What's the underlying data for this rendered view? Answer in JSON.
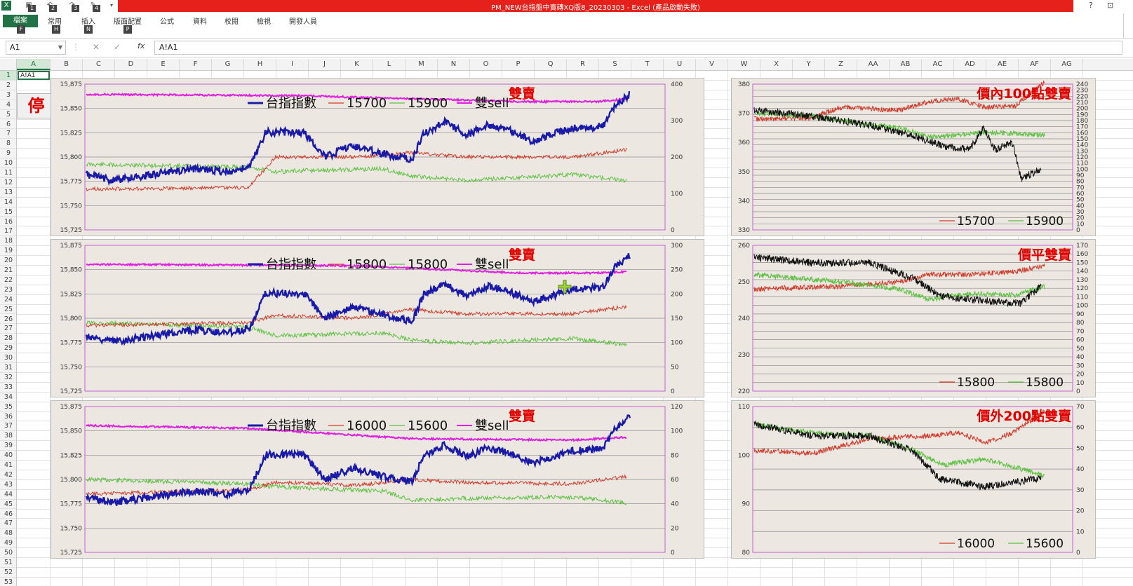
{
  "window": {
    "title": "PM_NEW台指盤中賣磚XQ版8_20230303 - Excel (產品啟動失敗)",
    "help": "?",
    "restore": "⊡"
  },
  "qat": {
    "keys": [
      "1",
      "2",
      "3",
      "4"
    ]
  },
  "ribbon": {
    "file": {
      "label": "檔案",
      "key": "F"
    },
    "tabs": [
      {
        "label": "常用",
        "key": "H"
      },
      {
        "label": "插入",
        "key": "N"
      },
      {
        "label": "版面配置",
        "key": "P"
      },
      {
        "label": "公式"
      },
      {
        "label": "資料"
      },
      {
        "label": "校閱"
      },
      {
        "label": "檢視"
      },
      {
        "label": "開發人員"
      }
    ]
  },
  "formula_bar": {
    "name_box": "A1",
    "formula": "A!A1"
  },
  "sheet": {
    "columns": [
      "A",
      "B",
      "C",
      "D",
      "E",
      "F",
      "G",
      "H",
      "I",
      "J",
      "K",
      "L",
      "M",
      "N",
      "O",
      "P",
      "Q",
      "R",
      "S",
      "T",
      "U",
      "V",
      "W",
      "X",
      "Y",
      "Z",
      "AA",
      "AB",
      "AC",
      "AD",
      "AE",
      "AF",
      "AG"
    ],
    "selected_column": "A",
    "selected_row": "1",
    "a1_value": "A!A1",
    "stop_button": "停"
  },
  "colors": {
    "index": "#1a1aa8",
    "red_line": "#d23a2a",
    "green_line": "#5cc040",
    "pink_line": "#e020e0",
    "black_line": "#111111",
    "title_red": "#e00000",
    "excel_green": "#217346"
  },
  "charts": {
    "left": [
      {
        "title": "雙賣",
        "legend": [
          "台指指數",
          "15700",
          "15900",
          "雙sell"
        ],
        "left_ticks": [
          "15,875",
          "15,850",
          "15,825",
          "15,800",
          "15,775",
          "15,750",
          "15,725"
        ],
        "right_ticks": [
          "400",
          "300",
          "200",
          "100",
          "0"
        ]
      },
      {
        "title": "雙賣",
        "legend": [
          "台指指數",
          "15800",
          "15800",
          "雙sell"
        ],
        "left_ticks": [
          "15,875",
          "15,850",
          "15,825",
          "15,800",
          "15,775",
          "15,750",
          "15,725"
        ],
        "right_ticks": [
          "300",
          "250",
          "200",
          "150",
          "100",
          "50",
          "0"
        ]
      },
      {
        "title": "雙賣",
        "legend": [
          "台指指數",
          "16000",
          "15600",
          "雙sell"
        ],
        "left_ticks": [
          "15,875",
          "15,850",
          "15,825",
          "15,800",
          "15,775",
          "15,750",
          "15,725"
        ],
        "right_ticks": [
          "120",
          "100",
          "80",
          "60",
          "40",
          "20",
          "0"
        ]
      }
    ],
    "right": [
      {
        "title": "價內100點雙賣",
        "legend": [
          "15700",
          "15900"
        ],
        "left_ticks": [
          "380",
          "370",
          "360",
          "350",
          "340",
          "330"
        ],
        "right_ticks": [
          "240",
          "230",
          "220",
          "210",
          "200",
          "190",
          "180",
          "170",
          "160",
          "150",
          "140",
          "130",
          "120",
          "110",
          "100",
          "90",
          "80",
          "70",
          "60",
          "50",
          "40",
          "30",
          "20",
          "10",
          "0"
        ]
      },
      {
        "title": "價平雙賣",
        "legend": [
          "15800",
          "15800"
        ],
        "left_ticks": [
          "260",
          "250",
          "240",
          "230",
          "220"
        ],
        "right_ticks": [
          "170",
          "160",
          "150",
          "140",
          "130",
          "120",
          "110",
          "100",
          "90",
          "80",
          "70",
          "60",
          "50",
          "40",
          "30",
          "20",
          "10",
          "0"
        ]
      },
      {
        "title": "價外200點雙賣",
        "legend": [
          "16000",
          "15600"
        ],
        "left_ticks": [
          "110",
          "100",
          "90",
          "80"
        ],
        "right_ticks": [
          "70",
          "60",
          "50",
          "40",
          "30",
          "20",
          "10",
          "0"
        ]
      }
    ]
  }
}
